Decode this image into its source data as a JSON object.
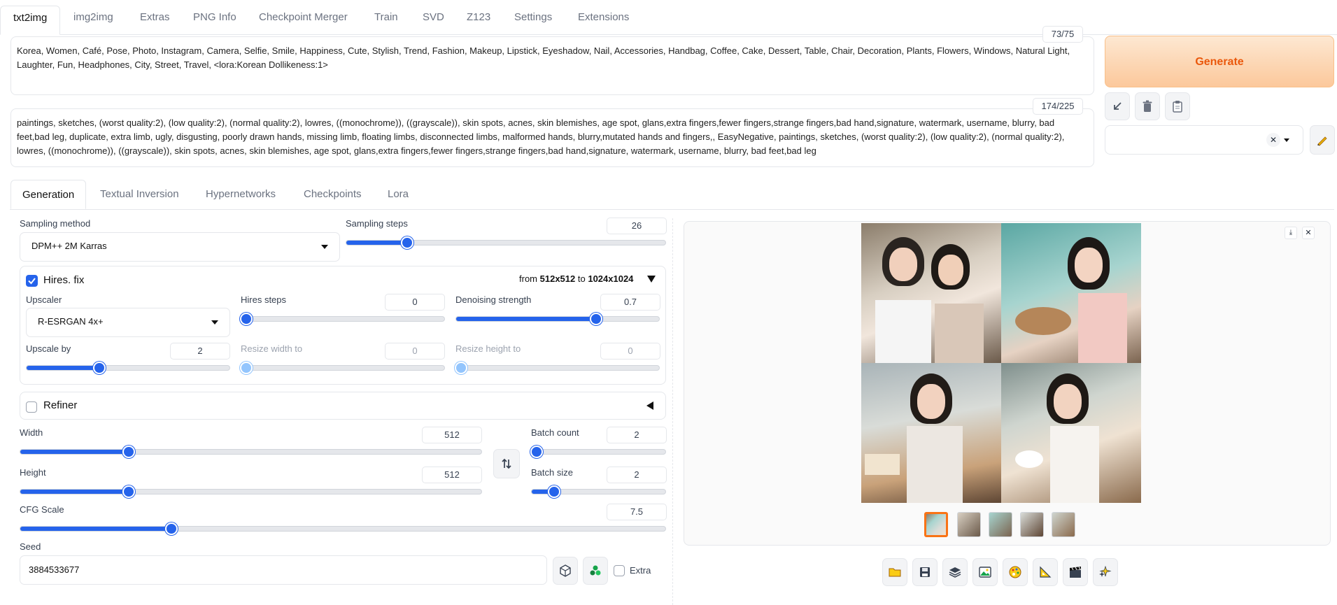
{
  "top_tabs": [
    "txt2img",
    "img2img",
    "Extras",
    "PNG Info",
    "Checkpoint Merger",
    "Train",
    "SVD",
    "Z123",
    "Settings",
    "Extensions"
  ],
  "prompt": {
    "text": "Korea, Women, Café, Pose, Photo, Instagram, Camera, Selfie, Smile, Happiness, Cute, Stylish, Trend, Fashion, Makeup, Lipstick, Eyeshadow, Nail, Accessories, Handbag, Coffee, Cake, Dessert, Table, Chair, Decoration, Plants, Flowers, Windows, Natural Light, Laughter, Fun, Headphones, City, Street, Travel, <lora:Korean Dollikeness:1>",
    "counter": "73/75"
  },
  "negative_prompt": {
    "text": "paintings, sketches, (worst quality:2), (low quality:2), (normal quality:2), lowres, ((monochrome)), ((grayscale)), skin spots, acnes, skin blemishes, age spot, glans,extra fingers,fewer fingers,strange fingers,bad hand,signature, watermark, username, blurry, bad feet,bad leg, duplicate, extra limb, ugly, disgusting, poorly drawn hands, missing limb, floating limbs, disconnected limbs, malformed hands, blurry,mutated hands and fingers,, EasyNegative, paintings, sketches, (worst quality:2), (low quality:2), (normal quality:2), lowres, ((monochrome)), ((grayscale)), skin spots, acnes, skin blemishes, age spot, glans,extra fingers,fewer fingers,strange fingers,bad hand,signature, watermark, username, blurry, bad feet,bad leg",
    "counter": "174/225"
  },
  "generate_label": "Generate",
  "sub_tabs": [
    "Generation",
    "Textual Inversion",
    "Hypernetworks",
    "Checkpoints",
    "Lora"
  ],
  "sampling": {
    "method_label": "Sampling method",
    "method_value": "DPM++ 2M Karras",
    "steps_label": "Sampling steps",
    "steps_value": "26",
    "steps_frac": 0.18
  },
  "hires": {
    "label": "Hires. fix",
    "checked": true,
    "from_prefix": "from",
    "from_size": "512x512",
    "to_prefix": "to",
    "to_size": "1024x1024",
    "upscaler_label": "Upscaler",
    "upscaler_value": "R-ESRGAN 4x+",
    "steps_label": "Hires steps",
    "steps_value": "0",
    "steps_frac": 0.0,
    "denoise_label": "Denoising strength",
    "denoise_value": "0.7",
    "denoise_frac": 0.7,
    "upscale_by_label": "Upscale by",
    "upscale_by_value": "2",
    "upscale_by_frac": 0.35,
    "resize_w_label": "Resize width to",
    "resize_w_value": "0",
    "resize_h_label": "Resize height to",
    "resize_h_value": "0"
  },
  "refiner": {
    "label": "Refiner",
    "checked": false
  },
  "width": {
    "label": "Width",
    "value": "512",
    "frac": 0.23
  },
  "height": {
    "label": "Height",
    "value": "512",
    "frac": 0.23
  },
  "batch_count": {
    "label": "Batch count",
    "value": "2",
    "frac": 0.0
  },
  "batch_size": {
    "label": "Batch size",
    "value": "2",
    "frac": 0.14
  },
  "cfg": {
    "label": "CFG Scale",
    "value": "7.5",
    "frac": 0.23
  },
  "seed": {
    "label": "Seed",
    "value": "3884533677",
    "extra_label": "Extra"
  },
  "colors": {
    "accent": "#2563eb",
    "generate_text": "#ea580c"
  }
}
